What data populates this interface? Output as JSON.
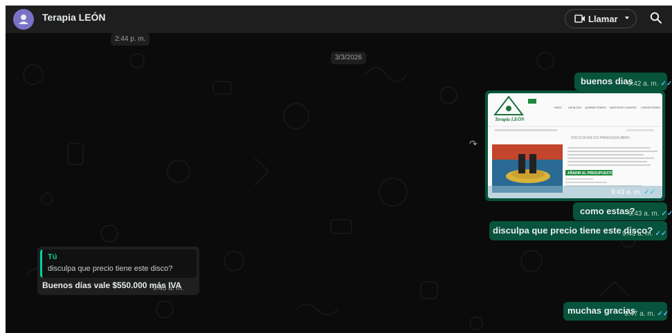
{
  "header": {
    "contact_name": "Terapia LEÓN",
    "call_label": "Llamar"
  },
  "date_pills": {
    "time_separator": "2:44 p. m.",
    "date_separator": "3/3/2026"
  },
  "messages": [
    {
      "direction": "out",
      "text": "buenos dias",
      "time": "9:42 a. m."
    },
    {
      "direction": "out",
      "type": "image",
      "time": "9:43 a. m."
    },
    {
      "direction": "out",
      "text": "como estas?",
      "time": "9:43 a. m."
    },
    {
      "direction": "out",
      "text": "disculpa que precio tiene este disco?",
      "time": "9:43 a. m."
    },
    {
      "direction": "in",
      "quote_author": "Tú",
      "quote_text": "disculpa que precio tiene este disco?",
      "text": "Buenos días vale $550.000 más IVA",
      "time": "9:45 a. m."
    },
    {
      "direction": "out",
      "text": "muchas gracias",
      "time": "9:47 a. m."
    }
  ],
  "image_preview": {
    "brand": "Terapia LEÓN",
    "nav": [
      "INICIO",
      "CATÁLOGO",
      "QUIENES SOMOS",
      "NUESTROS CLIENTES",
      "CONTÁCTENOS"
    ],
    "product_title": "DISCO ACRÍLICO PARA EQUILIBRIO",
    "cta": "AÑADIR AL PRESUPUESTO"
  },
  "colors": {
    "background": "#0b0b0b",
    "header": "#1e1e1e",
    "outgoing": "#07533b",
    "incoming": "#1f1f1f",
    "accent": "#06cf9c",
    "read_ticks": "#53bdeb"
  }
}
